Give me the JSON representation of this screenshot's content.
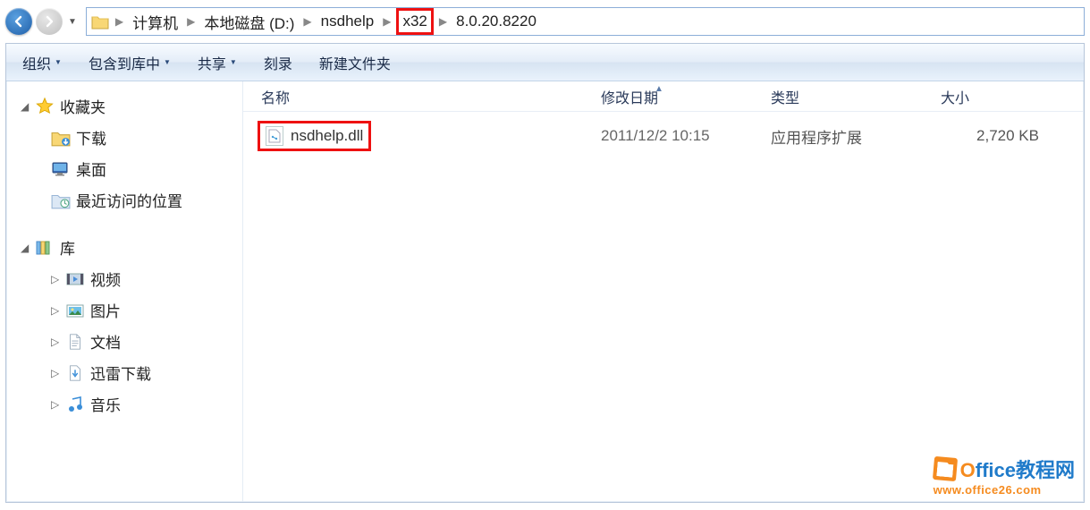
{
  "breadcrumb": {
    "items": [
      {
        "label": "计算机"
      },
      {
        "label": "本地磁盘 (D:)"
      },
      {
        "label": "nsdhelp"
      },
      {
        "label": "x32",
        "highlight": true
      },
      {
        "label": "8.0.20.8220"
      }
    ]
  },
  "toolbar": {
    "organize": "组织",
    "include": "包含到库中",
    "share": "共享",
    "burn": "刻录",
    "newfolder": "新建文件夹"
  },
  "sidebar": {
    "favorites": {
      "label": "收藏夹"
    },
    "downloads": {
      "label": "下载"
    },
    "desktop": {
      "label": "桌面"
    },
    "recent": {
      "label": "最近访问的位置"
    },
    "libraries": {
      "label": "库"
    },
    "videos": {
      "label": "视频"
    },
    "pictures": {
      "label": "图片"
    },
    "documents": {
      "label": "文档"
    },
    "xunlei": {
      "label": "迅雷下载"
    },
    "music": {
      "label": "音乐"
    }
  },
  "columns": {
    "name": "名称",
    "date": "修改日期",
    "type": "类型",
    "size": "大小"
  },
  "files": [
    {
      "name": "nsdhelp.dll",
      "date": "2011/12/2 10:15",
      "type": "应用程序扩展",
      "size": "2,720 KB",
      "highlight": true
    }
  ],
  "watermark": {
    "line1_a": "O",
    "line1_b": "ffice教程网",
    "line2": "www.office26.com"
  }
}
